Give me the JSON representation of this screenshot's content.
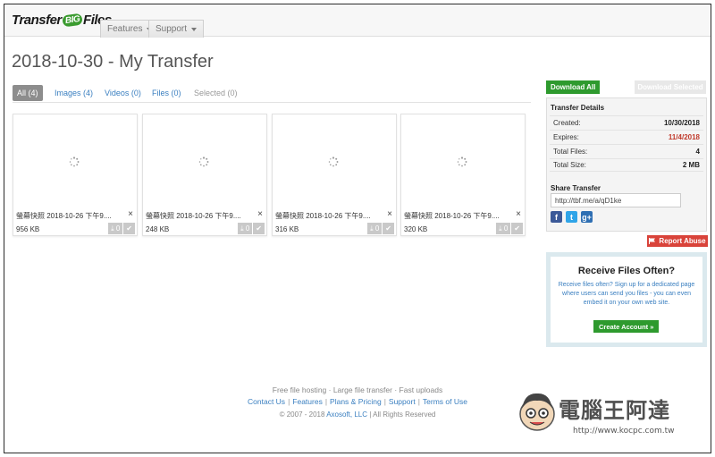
{
  "app": {
    "logo_text_1": "Transfer",
    "logo_text_2": "BIG",
    "logo_text_3": "Files"
  },
  "nav": {
    "features_label": "Features",
    "support_label": "Support"
  },
  "page_title": "2018-10-30 - My Transfer",
  "tabs": [
    {
      "label": "All (4)",
      "active": true
    },
    {
      "label": "Images (4)",
      "active": false
    },
    {
      "label": "Videos (0)",
      "active": false
    },
    {
      "label": "Files (0)",
      "active": false
    },
    {
      "label": "Selected (0)",
      "active": false
    }
  ],
  "files": [
    {
      "name": "螢幕快照 2018-10-26 下午9....",
      "size": "956 KB",
      "downloads": "0"
    },
    {
      "name": "螢幕快照 2018-10-26 下午9....",
      "size": "248 KB",
      "downloads": "0"
    },
    {
      "name": "螢幕快照 2018-10-26 下午9....",
      "size": "316 KB",
      "downloads": "0"
    },
    {
      "name": "螢幕快照 2018-10-26 下午9....",
      "size": "320 KB",
      "downloads": "0"
    }
  ],
  "icons": {
    "close": "×",
    "download": "⤓",
    "check": "✔"
  },
  "sidebar": {
    "download_all": "Download All",
    "download_selected": "Download Selected",
    "details_title": "Transfer Details",
    "details": [
      {
        "label": "Created:",
        "value": "10/30/2018"
      },
      {
        "label": "Expires:",
        "value": "11/4/2018"
      },
      {
        "label": "Total Files:",
        "value": "4"
      },
      {
        "label": "Total Size:",
        "value": "2 MB"
      }
    ],
    "share_title": "Share Transfer",
    "share_url": "http://tbf.me/a/qD1ke",
    "report_abuse": "Report Abuse",
    "receive_title": "Receive Files Often?",
    "receive_text": "Receive files often? Sign up for a dedicated page where users can send you files - you can even embed it on your own web site.",
    "create_account": "Create Account »"
  },
  "footer": {
    "tagline": "Free file hosting · Large file transfer · Fast uploads",
    "links": [
      "Contact Us",
      "Features",
      "Plans & Pricing",
      "Support",
      "Terms of Use"
    ],
    "copyright_pre": "© 2007 - 2018 ",
    "copyright_link": "Axosoft, LLC",
    "copyright_post": " | All Rights Reserved"
  },
  "watermark": {
    "title": "電腦王阿達",
    "url": "http://www.kocpc.com.tw"
  },
  "colors": {
    "accent_green": "#2e9a2e",
    "link_blue": "#3a7fc0",
    "danger_red": "#d9433a",
    "expires_red": "#c0392b"
  }
}
